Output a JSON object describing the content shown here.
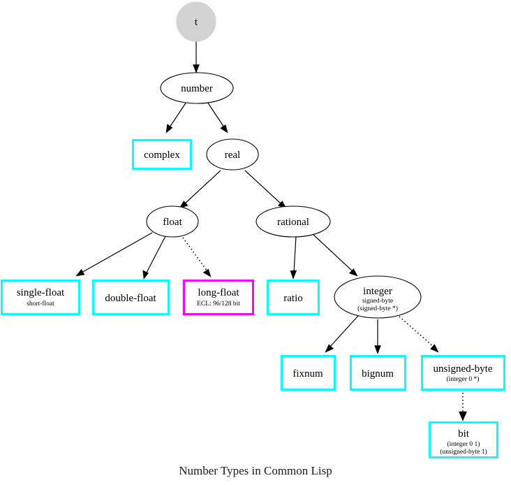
{
  "caption": "Number Types in Common Lisp",
  "colors": {
    "cyan": "#00FFFF",
    "magenta": "#FF00FF",
    "black": "#000000",
    "gray_fill": "#D3D3D3",
    "white": "#FFFFFF"
  },
  "nodes": {
    "t": {
      "label": "t",
      "shape": "circle",
      "style": "filled-gray",
      "sub": []
    },
    "number": {
      "label": "number",
      "shape": "ellipse",
      "style": "plain",
      "sub": []
    },
    "complex": {
      "label": "complex",
      "shape": "box",
      "style": "cyan",
      "sub": []
    },
    "real": {
      "label": "real",
      "shape": "ellipse",
      "style": "plain",
      "sub": []
    },
    "float": {
      "label": "float",
      "shape": "ellipse",
      "style": "plain",
      "sub": []
    },
    "rational": {
      "label": "rational",
      "shape": "ellipse",
      "style": "plain",
      "sub": []
    },
    "single_float": {
      "label": "single-float",
      "shape": "box",
      "style": "cyan",
      "sub": [
        "short-float"
      ]
    },
    "double_float": {
      "label": "double-float",
      "shape": "box",
      "style": "cyan",
      "sub": []
    },
    "long_float": {
      "label": "long-float",
      "shape": "box",
      "style": "magenta",
      "sub": [
        "ECL: 96/128 bit"
      ]
    },
    "ratio": {
      "label": "ratio",
      "shape": "box",
      "style": "cyan",
      "sub": []
    },
    "integer": {
      "label": "integer",
      "shape": "ellipse",
      "style": "plain",
      "sub": [
        "signed-byte",
        "(signed-byte *)"
      ]
    },
    "fixnum": {
      "label": "fixnum",
      "shape": "box",
      "style": "cyan",
      "sub": []
    },
    "bignum": {
      "label": "bignum",
      "shape": "box",
      "style": "cyan",
      "sub": []
    },
    "unsigned_byte": {
      "label": "unsigned-byte",
      "shape": "box",
      "style": "cyan",
      "sub": [
        "(integer 0 *)"
      ]
    },
    "bit": {
      "label": "bit",
      "shape": "box",
      "style": "cyan",
      "sub": [
        "(integer 0 1)",
        "(unsigned-byte 1)"
      ]
    }
  },
  "edges": [
    {
      "from": "t",
      "to": "number",
      "style": "solid"
    },
    {
      "from": "number",
      "to": "complex",
      "style": "solid"
    },
    {
      "from": "number",
      "to": "real",
      "style": "solid"
    },
    {
      "from": "real",
      "to": "float",
      "style": "solid"
    },
    {
      "from": "real",
      "to": "rational",
      "style": "solid"
    },
    {
      "from": "float",
      "to": "single_float",
      "style": "solid"
    },
    {
      "from": "float",
      "to": "double_float",
      "style": "solid"
    },
    {
      "from": "float",
      "to": "long_float",
      "style": "dotted"
    },
    {
      "from": "rational",
      "to": "ratio",
      "style": "solid"
    },
    {
      "from": "rational",
      "to": "integer",
      "style": "solid"
    },
    {
      "from": "integer",
      "to": "fixnum",
      "style": "solid"
    },
    {
      "from": "integer",
      "to": "bignum",
      "style": "solid"
    },
    {
      "from": "integer",
      "to": "unsigned_byte",
      "style": "dotted"
    },
    {
      "from": "unsigned_byte",
      "to": "bit",
      "style": "dotted"
    }
  ]
}
